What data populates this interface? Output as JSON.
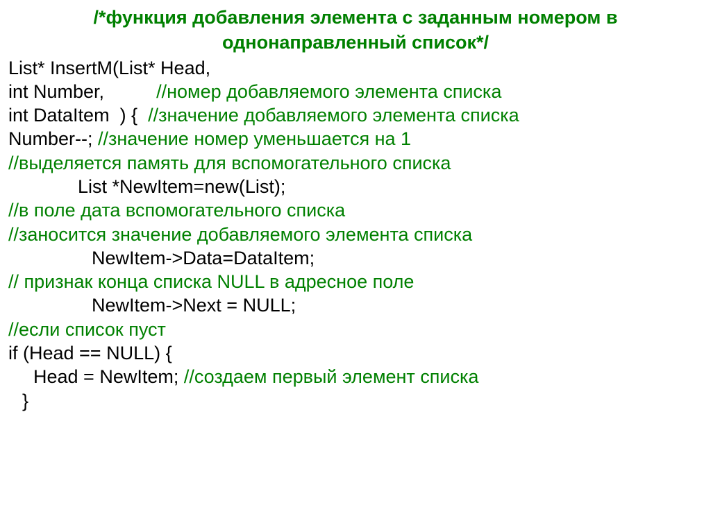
{
  "title1": "/*функция добавления элемента с заданным номером в",
  "title2": "однонаправленный список*/",
  "l1_code": "List* InsertM(List* Head,",
  "l2_code": "int Number,          ",
  "l2_comment": "//номер добавляемого элемента списка",
  "l3_code": "int DataItem  ) {  ",
  "l3_comment": "//значение добавляемого элемента списка",
  "l4_code": "Number--; ",
  "l4_comment": "//значение номер уменьшается на 1",
  "l5_comment": "//выделяется память для вспомогательного списка",
  "l6_code": "List *NewItem=new(List);",
  "l7_comment": "//в поле дата вспомогательного списка",
  "l8_comment": "//заносится значение добавляемого элемента списка",
  "l9_code": "NewItem->Data=DataItem;",
  "l10_comment": "// признак конца списка NULL в адресное поле",
  "l11_code": "NewItem->Next = NULL;",
  "l12_comment": "//если список пуст",
  "l13_code": "if (Head == NULL) {",
  "l14_code": "Head = NewItem; ",
  "l14_comment": "//создаем первый элемент списка",
  "l15_code": "}"
}
